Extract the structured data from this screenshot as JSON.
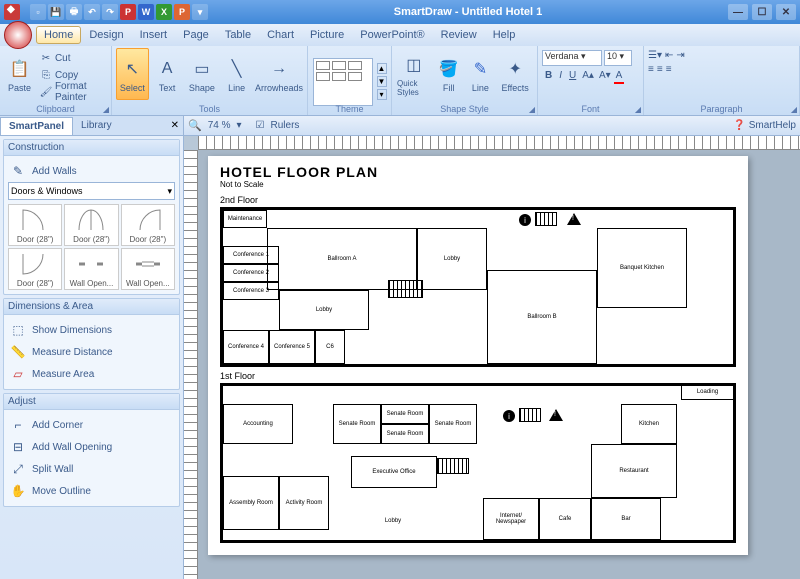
{
  "titlebar": {
    "title": "SmartDraw - Untitled Hotel 1"
  },
  "menus": [
    "Home",
    "Design",
    "Insert",
    "Page",
    "Table",
    "Chart",
    "Picture",
    "PowerPoint®",
    "Review",
    "Help"
  ],
  "active_menu": 0,
  "ribbon": {
    "clipboard": {
      "label": "Clipboard",
      "paste": "Paste",
      "cut": "Cut",
      "copy": "Copy",
      "fmtpaint": "Format Painter"
    },
    "tools": {
      "label": "Tools",
      "select": "Select",
      "text": "Text",
      "shape": "Shape",
      "line": "Line",
      "arrowheads": "Arrowheads"
    },
    "theme": {
      "label": "Theme"
    },
    "shapestyle": {
      "label": "Shape Style",
      "quick": "Quick Styles",
      "fill": "Fill",
      "line": "Line",
      "effects": "Effects"
    },
    "font": {
      "label": "Font",
      "family": "Verdana",
      "size": "10"
    },
    "paragraph": {
      "label": "Paragraph"
    }
  },
  "leftpanel": {
    "tabs": [
      "SmartPanel",
      "Library"
    ],
    "active_tab": 0,
    "construction": {
      "label": "Construction",
      "add_walls": "Add Walls",
      "dropdown": "Doors & Windows",
      "shapes": [
        "Door (28\")",
        "Door (28\")",
        "Door (28\")",
        "Door (28\")",
        "Wall Open...",
        "Wall Open..."
      ]
    },
    "dim_area": {
      "label": "Dimensions & Area",
      "items": [
        "Show Dimensions",
        "Measure Distance",
        "Measure Area"
      ]
    },
    "adjust": {
      "label": "Adjust",
      "items": [
        "Add Corner",
        "Add Wall Opening",
        "Split Wall",
        "Move Outline"
      ]
    }
  },
  "canvas_bar": {
    "zoom": "74 %",
    "rulers": "Rulers",
    "smarthelp": "SmartHelp"
  },
  "doc": {
    "title": "HOTEL FLOOR PLAN",
    "subtitle": "Not to Scale",
    "floor2": {
      "label": "2nd Floor",
      "rooms": {
        "maint": "Maintenance",
        "ballA": "Ballroom A",
        "lobby1": "Lobby",
        "conf1": "Conference 1",
        "conf2": "Conference 2",
        "conf3": "Conference 3",
        "lobby2": "Lobby",
        "conf4": "Conference 4",
        "conf5": "Conference 5",
        "c6": "C6",
        "ballB": "Ballroom B",
        "banquet": "Banquet Kitchen"
      }
    },
    "floor1": {
      "label": "1st Floor",
      "rooms": {
        "acct": "Accounting",
        "sr1": "Senate Room",
        "sr2": "Senate Room",
        "sr3": "Senate Room",
        "sr4": "Senate Room",
        "loading": "Loading",
        "kitchen": "Kitchen",
        "exec": "Executive Office",
        "assembly": "Assembly Room",
        "activity": "Activity Room",
        "lobby": "Lobby",
        "internet": "Internet/ Newspaper",
        "cafe": "Cafe",
        "bar": "Bar",
        "rest": "Restaurant"
      }
    }
  }
}
